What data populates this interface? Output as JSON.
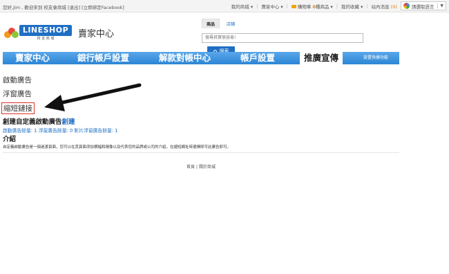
{
  "topbar": {
    "greeting": "您好,Jim , 歡迎來到 校友會商城",
    "logout": "[退出]",
    "bind_facebook": "[立即綁定Facebook]",
    "my_store": "我的商城 ▾",
    "seller_center": "賣家中心 ▾",
    "cart_label": "購物車",
    "cart_count": "0",
    "cart_suffix": "種商品 ▾",
    "favorites": "我的收藏 ▾",
    "messages_label": "站內消息",
    "messages_count": "(0)",
    "translate_label": "請選取語言",
    "translate_arrow": "▼",
    "separator": "|"
  },
  "header": {
    "logo_text": "LINESHOP",
    "logo_sub": "校 友 商 城",
    "title": "賣家中心",
    "search": {
      "tab_products": "商品",
      "tab_stores": "店鋪",
      "placeholder": "搜尋其實很容易!",
      "button": "搜索"
    }
  },
  "nav": {
    "items": [
      {
        "label": "賣家中心"
      },
      {
        "label": "銀行帳戶設置"
      },
      {
        "label": "解款對帳中心"
      },
      {
        "label": "帳戶設置"
      },
      {
        "label": "推廣宣傳"
      },
      {
        "label": "設置快捷功能"
      }
    ]
  },
  "sidebar": {
    "items": [
      {
        "label": "啟動廣告"
      },
      {
        "label": "浮窗廣告"
      },
      {
        "label": "縮短鏈接"
      }
    ]
  },
  "main": {
    "create_title": "創建自定義啟動廣告",
    "create_link": "創建",
    "counts": "啟動廣告餘量: 1 浮窗廣告餘量: 0 影片浮窗廣告餘量: 1",
    "intro_title": "介紹",
    "intro_text": "自定義啟動廣告是一個過渡頁面，您可以在其頁面添加横幅和鏈像以及代表您的品牌或公司的介紹，在縮短網址時選擇即可此廣告即可。"
  },
  "footer": {
    "home": "首頁",
    "separator": "|",
    "about": "關於商城"
  }
}
